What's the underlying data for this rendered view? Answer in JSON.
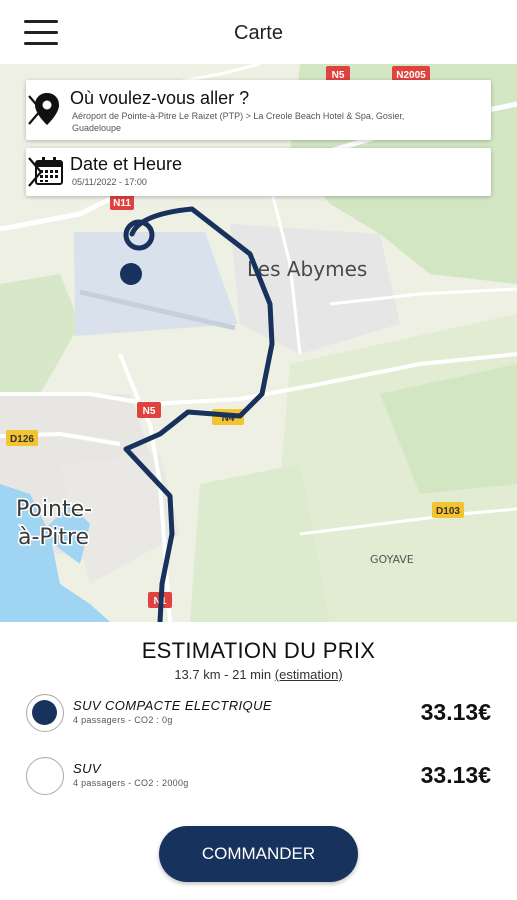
{
  "header": {
    "title": "Carte",
    "menu_icon": "hamburger-menu-icon"
  },
  "map": {
    "labels": {
      "les_abymes": "Les Abymes",
      "pointe_a_pitre_line1": "Pointe-",
      "pointe_a_pitre_line2": "à-Pitre",
      "goyave": "GOYAVE",
      "n5_top": "N5",
      "n2005": "N2005",
      "n11": "N11",
      "n5_mid": "N5",
      "d126": "D126",
      "d103": "D103",
      "n1": "N1",
      "n4": "N4"
    },
    "route_color": "#17325c"
  },
  "destination": {
    "label": "Où voulez-vous aller ?",
    "route_text": "Aéroport de Pointe-à-Pitre Le Raizet (PTP) > La Creole Beach Hotel & Spa, Gosier, Guadeloupe",
    "icon": "map-pin-icon"
  },
  "datetime": {
    "label": "Date et Heure",
    "value": "05/11/2022 - 17:00",
    "icon": "calendar-icon"
  },
  "estimate": {
    "title": "ESTIMATION DU PRIX",
    "summary": "13.7 km - 21 min",
    "link": "(estimation)"
  },
  "options": [
    {
      "name": "SUV COMPACTE ELECTRIQUE",
      "desc": "4 passagers - CO2 : 0g",
      "price": "33.13€",
      "selected": true
    },
    {
      "name": "SUV",
      "desc": "4 passagers - CO2 : 2000g",
      "price": "33.13€",
      "selected": false
    }
  ],
  "cta": {
    "label": "COMMANDER"
  },
  "colors": {
    "accent": "#17325c",
    "map_land": "#eef0e4",
    "map_sea": "#9fd4f3"
  }
}
